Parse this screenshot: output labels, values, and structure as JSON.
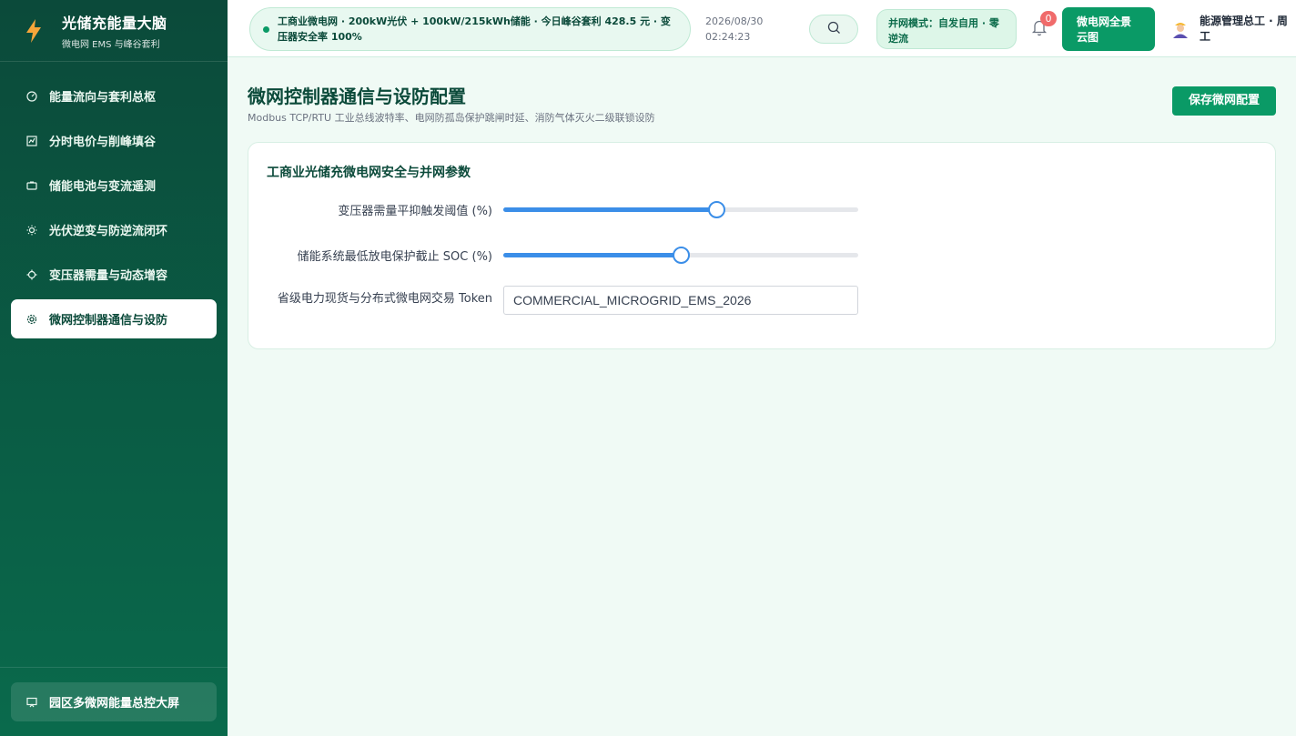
{
  "brand": {
    "title": "光储充能量大脑",
    "subtitle": "微电网 EMS 与峰谷套利"
  },
  "sidebar": {
    "items": [
      {
        "label": "能量流向与套利总枢",
        "icon": "gauge-icon",
        "active": false
      },
      {
        "label": "分时电价与削峰填谷",
        "icon": "chart-icon",
        "active": false
      },
      {
        "label": "储能电池与变流遥测",
        "icon": "battery-icon",
        "active": false
      },
      {
        "label": "光伏逆变与防逆流闭环",
        "icon": "sun-icon",
        "active": false
      },
      {
        "label": "变压器需量与动态增容",
        "icon": "transformer-icon",
        "active": false
      },
      {
        "label": "微网控制器通信与设防",
        "icon": "gear-icon",
        "active": true
      }
    ],
    "bottom_button": {
      "label": "园区多微网能量总控大屏",
      "icon": "monitor-icon"
    }
  },
  "header": {
    "status_text": "工商业微电网 · 200kW光伏 + 100kW/215kWh储能 · 今日峰谷套利 428.5 元 · 变压器安全率 100%",
    "date": "2026/08/30",
    "time": "02:24:23",
    "mode_text": "并网模式：自发自用 · 零逆流",
    "notification_count": "0",
    "cloud_button": "微电网全景云图",
    "user_name": "能源管理总工 · 周工"
  },
  "main": {
    "title": "微网控制器通信与设防配置",
    "subtitle": "Modbus TCP/RTU 工业总线波特率、电网防孤岛保护跳闸时延、消防气体灭火二级联锁设防",
    "save_button": "保存微网配置",
    "card": {
      "title": "工商业光储充微电网安全与并网参数",
      "slider1": {
        "label": "变压器需量平抑触发阈值 (%)",
        "value": 60
      },
      "slider2": {
        "label": "储能系统最低放电保护截止 SOC (%)",
        "value": 50
      },
      "token": {
        "label": "省级电力现货与分布式微电网交易 Token",
        "value": "COMMERCIAL_MICROGRID_EMS_2026"
      }
    }
  },
  "colors": {
    "sidebar_top": "#0b4a3a",
    "accent": "#0a9a66",
    "slider": "#3b8ee8",
    "badge": "#f06b6b"
  }
}
